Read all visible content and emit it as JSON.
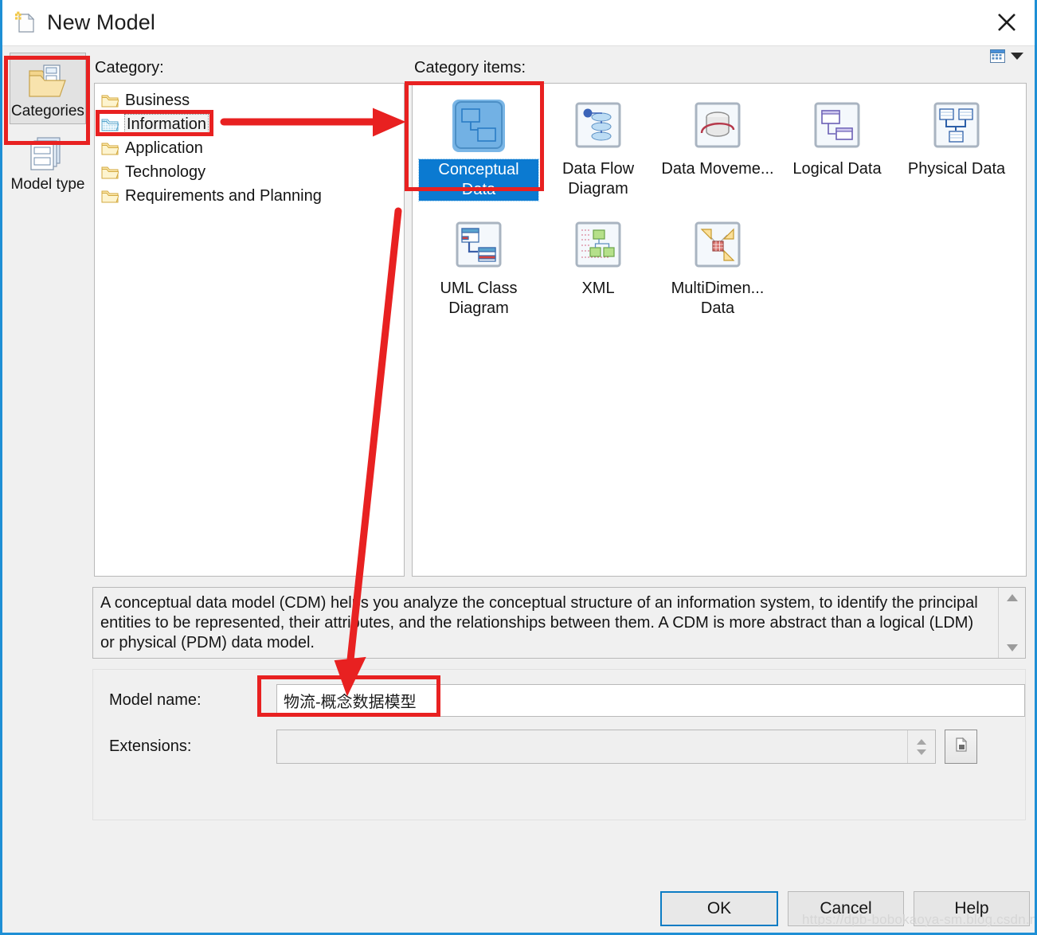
{
  "window": {
    "title": "New Model",
    "title_icon": "new-model-document-icon",
    "close_icon": "close-icon"
  },
  "toolbar": {
    "view_mode_icon": "grid-view-icon",
    "dropdown_icon": "chevron-down-icon"
  },
  "rail": {
    "items": [
      {
        "label": "Categories",
        "icon": "folder-documents-icon",
        "selected": true
      },
      {
        "label": "Model type",
        "icon": "stacked-windows-icon",
        "selected": false
      }
    ]
  },
  "headers": {
    "category": "Category:",
    "category_items": "Category items:"
  },
  "category_list": {
    "items": [
      {
        "label": "Business",
        "icon": "folder-icon",
        "selected": false
      },
      {
        "label": "Information",
        "icon": "folder-icon",
        "selected": true
      },
      {
        "label": "Application",
        "icon": "folder-icon",
        "selected": false
      },
      {
        "label": "Technology",
        "icon": "folder-icon",
        "selected": false
      },
      {
        "label": "Requirements and Planning",
        "icon": "folder-icon",
        "selected": false
      }
    ]
  },
  "category_items": {
    "items": [
      {
        "label": "Conceptual Data",
        "icon": "conceptual-data-icon",
        "selected": true
      },
      {
        "label": "Data Flow Diagram",
        "icon": "data-flow-diagram-icon",
        "selected": false
      },
      {
        "label": "Data Moveme...",
        "icon": "data-movement-icon",
        "selected": false
      },
      {
        "label": "Logical Data",
        "icon": "logical-data-icon",
        "selected": false
      },
      {
        "label": "Physical Data",
        "icon": "physical-data-icon",
        "selected": false
      },
      {
        "label": "UML Class Diagram",
        "icon": "uml-class-diagram-icon",
        "selected": false
      },
      {
        "label": "XML",
        "icon": "xml-icon",
        "selected": false
      },
      {
        "label": "MultiDimen... Data",
        "icon": "multidimensional-data-icon",
        "selected": false
      }
    ]
  },
  "description": {
    "text": "A conceptual data model (CDM) helps you analyze the conceptual structure of an information system, to identify the principal entities to be represented, their attributes, and the relationships between them. A CDM is more abstract than a logical (LDM) or physical (PDM) data model.",
    "scroll_up_icon": "chevron-up-icon",
    "scroll_down_icon": "chevron-down-icon"
  },
  "form": {
    "model_name_label": "Model name:",
    "model_name_value": "物流-概念数据模型",
    "extensions_label": "Extensions:",
    "extensions_value": "",
    "browse_icon": "browse-file-icon"
  },
  "buttons": {
    "ok": "OK",
    "cancel": "Cancel",
    "help": "Help"
  },
  "watermark": "https://dpb-bobokaoya-sm.blog.csdn.net",
  "colors": {
    "accent_blue": "#1e8fd5",
    "selection_blue": "#0b7ad1",
    "annotation_red": "#e82121",
    "dialog_bg": "#f0f0f0"
  }
}
